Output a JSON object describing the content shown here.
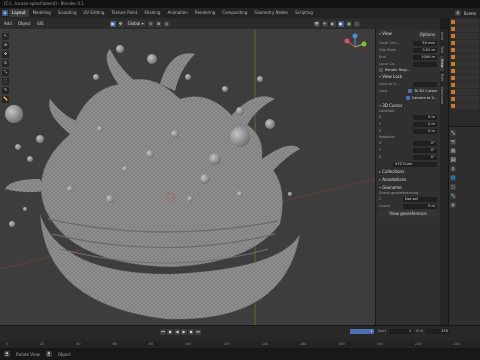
{
  "window": {
    "title": "[C:\\...\\ocean-splash\\blend] - Blender 4.1"
  },
  "workspaces": [
    "Layout",
    "Modeling",
    "Sculpting",
    "UV Editing",
    "Texture Paint",
    "Shading",
    "Animation",
    "Rendering",
    "Compositing",
    "Geometry Nodes",
    "Scripting"
  ],
  "scene_label": "Scene",
  "header": {
    "menus": [
      "Add",
      "Object",
      "GIS"
    ],
    "orientation": "Global"
  },
  "npanel": {
    "tabs": [
      "View",
      "Options"
    ],
    "view": {
      "title": "View",
      "focal_length_label": "Focal Len...",
      "focal_length": "50 mm",
      "clip_start_label": "Clip Start",
      "clip_start": "0.01 m",
      "clip_end_label": "End",
      "clip_end": "1000 m",
      "local_camera_label": "Local Ca...",
      "render_region_label": "Render Regi..."
    },
    "view_lock": {
      "title": "View Lock",
      "lock_to_object_label": "Lock to O...",
      "lock_label": "Lock",
      "to_3d_cursor": "To 3D Cursor",
      "camera_to_view": "Camera to V..."
    },
    "cursor": {
      "title": "3D Cursor",
      "location_label": "Location:",
      "location": [
        {
          "axis": "X",
          "value": "0 m"
        },
        {
          "axis": "Y",
          "value": "0 m"
        },
        {
          "axis": "Z",
          "value": "0 m"
        }
      ],
      "rotation_label": "Rotation:",
      "rotation": [
        {
          "axis": "X",
          "value": "0°"
        },
        {
          "axis": "Y",
          "value": "0°"
        },
        {
          "axis": "Z",
          "value": "0°"
        }
      ],
      "rotation_mode": "XYZ Euler"
    },
    "collections": "Collections",
    "annotations": "Annotations",
    "geonome": {
      "title": "Geonome",
      "scene_georef_label": "Scene georeferencing :",
      "crs_label": "C",
      "crs_value": "Not set",
      "coords_label": "Coord",
      "coords_value": "0 m",
      "btn_label": "View georeference"
    }
  },
  "vtabs": [
    "Item",
    "Tool",
    "View",
    "Edit",
    "Geonome"
  ],
  "timeline": {
    "current_frame": "1",
    "start_label": "Start",
    "start": "1",
    "end_label": "End",
    "end": "250",
    "ticks": [
      "0",
      "20",
      "40",
      "60",
      "80",
      "100",
      "120",
      "140",
      "160",
      "180",
      "200",
      "220",
      "240"
    ]
  },
  "status": {
    "items": [
      "Rotate View",
      "Object"
    ]
  },
  "colors": {
    "viewport_bg": "#3d3d3d",
    "accent": "#4772b3",
    "mesh_fill": "#8c8c8c"
  }
}
